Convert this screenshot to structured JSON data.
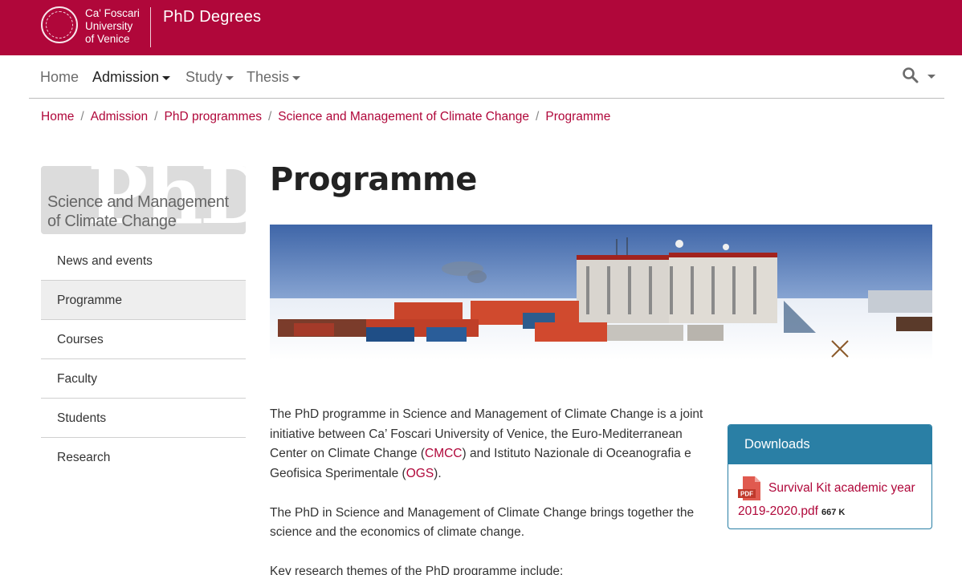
{
  "header": {
    "university": [
      "Ca' Foscari",
      "University",
      "of Venice"
    ],
    "site_title": "PhD Degrees"
  },
  "nav": {
    "items": [
      {
        "label": "Home",
        "has_caret": false,
        "active": false
      },
      {
        "label": "Admission",
        "has_caret": true,
        "active": true
      },
      {
        "label": "Study",
        "has_caret": true,
        "active": false
      },
      {
        "label": "Thesis",
        "has_caret": true,
        "active": false
      }
    ],
    "search_icon": "search-icon"
  },
  "breadcrumb": [
    "Home",
    "Admission",
    "PhD programmes",
    "Science and Management of Climate Change",
    "Programme"
  ],
  "sidebar": {
    "banner_ghost": "PhD",
    "banner_title_1": "Science and Management",
    "banner_title_2": "of Climate Change",
    "items": [
      {
        "label": "News and events",
        "active": false
      },
      {
        "label": "Programme",
        "active": true
      },
      {
        "label": "Courses",
        "active": false
      },
      {
        "label": "Faculty",
        "active": false
      },
      {
        "label": "Students",
        "active": false
      },
      {
        "label": "Research",
        "active": false
      }
    ]
  },
  "main": {
    "title": "Programme",
    "p1_part1": "The PhD programme in Science and Management of Climate Change is a joint initiative between Ca’ Foscari University of Venice, the Euro-Mediterranean Center on Climate Change (",
    "p1_link1": "CMCC",
    "p1_part2": ") and Istituto Nazionale di Oceanografia e Geofisica Sperimentale (",
    "p1_link2": "OGS",
    "p1_part3": ").",
    "p2": "The PhD in Science and Management of Climate Change brings together the science and the economics of climate change.",
    "p3": "Key research themes of the PhD programme include:"
  },
  "downloads": {
    "heading": "Downloads",
    "file_icon": "PDF",
    "file_name": "Survival Kit academic year 2019-2020.pdf",
    "file_size": "667 K"
  },
  "colors": {
    "brand": "#b0073a",
    "downloads_accent": "#2a7fa5"
  }
}
